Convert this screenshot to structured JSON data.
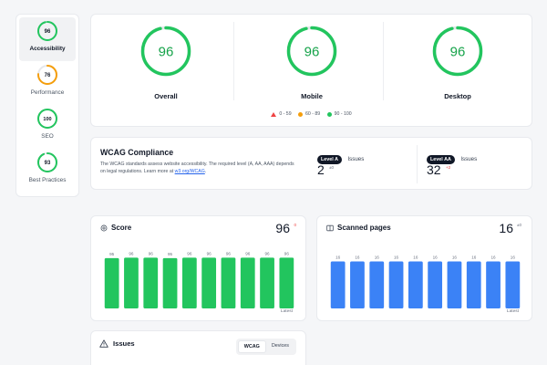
{
  "colors": {
    "green": "#22c55e",
    "orange": "#f59e0b",
    "red": "#ef4444",
    "blue": "#3b82f6",
    "track": "#e5e7eb"
  },
  "sidebar": {
    "items": [
      {
        "label": "Accessibility",
        "score": "96",
        "value": 96,
        "color": "#22c55e",
        "active": true
      },
      {
        "label": "Performance",
        "score": "76",
        "value": 76,
        "color": "#f59e0b",
        "active": false
      },
      {
        "label": "SEO",
        "score": "100",
        "value": 100,
        "color": "#22c55e",
        "active": false
      },
      {
        "label": "Best Practices",
        "score": "93",
        "value": 93,
        "color": "#22c55e",
        "active": false
      }
    ]
  },
  "overview": {
    "gauges": [
      {
        "label": "Overall",
        "score": "96",
        "value": 96
      },
      {
        "label": "Mobile",
        "score": "96",
        "value": 96
      },
      {
        "label": "Desktop",
        "score": "96",
        "value": 96
      }
    ],
    "legend": {
      "low": "0 - 59",
      "mid": "60 - 89",
      "high": "90 - 100"
    }
  },
  "wcag": {
    "title": "WCAG Compliance",
    "description": "The WCAG standards assess website accessibility. The required level (A, AA, AAA) depends on legal regulations. Learn more at ",
    "link": "w3.org/WCAG",
    "link_suffix": ".",
    "level_a": {
      "badge": "Level A",
      "issues_label": "Issues",
      "count": "2",
      "delta": "±0"
    },
    "level_aa": {
      "badge": "Level AA",
      "issues_label": "Issues",
      "count": "32",
      "delta": "+2"
    }
  },
  "score_card": {
    "title": "Score",
    "value": "96",
    "delta": "0",
    "icon": "gauge-icon",
    "latest_label": "Latest"
  },
  "pages_card": {
    "title": "Scanned pages",
    "value": "16",
    "delta": "±0",
    "icon": "pages-icon",
    "latest_label": "Latest"
  },
  "issues": {
    "title": "Issues",
    "icon": "warning-icon",
    "tabs": [
      "WCAG",
      "Devices"
    ],
    "active_tab": "WCAG"
  },
  "chart_data": [
    {
      "type": "bar",
      "title": "Score",
      "values": [
        95,
        96,
        96,
        95,
        96,
        96,
        96,
        96,
        96,
        96
      ],
      "ylim": [
        0,
        100
      ],
      "color": "#22c55e"
    },
    {
      "type": "bar",
      "title": "Scanned pages",
      "values": [
        16,
        16,
        16,
        16,
        16,
        16,
        16,
        16,
        16,
        16
      ],
      "ylim": [
        0,
        18
      ],
      "color": "#3b82f6"
    }
  ]
}
